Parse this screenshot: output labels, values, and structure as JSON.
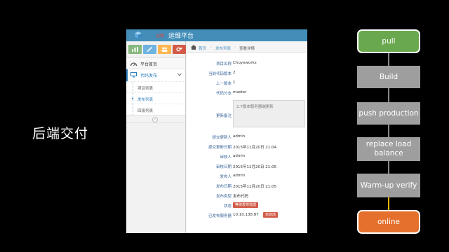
{
  "slide": {
    "title": "后端交付"
  },
  "app": {
    "brand": "运维平台",
    "logo_text": "运维",
    "shortcuts": [
      {
        "icon": "chart-icon",
        "color": "#87b87f"
      },
      {
        "icon": "pencil-icon",
        "color": "#6fb3e0"
      },
      {
        "icon": "users-icon",
        "color": "#ffb752"
      },
      {
        "icon": "cogs-icon",
        "color": "#d15b47"
      }
    ],
    "sidebar": {
      "home": "平台首页",
      "deploy": "代码发布",
      "sub_items": [
        "项目列表",
        "发布列表",
        "回滚列表"
      ],
      "collapse_glyph": "«"
    },
    "breadcrumb": [
      "首页",
      "发布列表",
      "查看详情"
    ],
    "breadcrumb_sep": "›",
    "details": [
      {
        "label": "项目名称",
        "value": "Chuyeworks"
      },
      {
        "label": "当前代码版本",
        "value": "2"
      },
      {
        "label": "上一版本",
        "value": "1"
      },
      {
        "label": "代码分支",
        "value": "master"
      },
      {
        "label": "更新备注",
        "value": "2.7版本服务器端更新"
      },
      {
        "label": "提交更新人",
        "value": "admin"
      },
      {
        "label": "提交更新日期",
        "value": "2015年11月20日 21:04"
      },
      {
        "label": "审核人",
        "value": "admin"
      },
      {
        "label": "审核日期",
        "value": "2015年11月20日 21:05"
      },
      {
        "label": "发布人",
        "value": "admin"
      },
      {
        "label": "发布日期",
        "value": "2015年11月20日 21:05"
      },
      {
        "label": "发布类型",
        "value": "发布代码"
      },
      {
        "label": "状态",
        "value": "等待发布完成"
      },
      {
        "label": "已发布服务器",
        "value": "10.10.138.87",
        "badge": "未启动"
      }
    ]
  },
  "flow": {
    "steps": [
      "pull",
      "Build",
      "push production",
      "replace load balance",
      "Warm-up verify",
      "online"
    ],
    "colors": {
      "start": "#6aa84f",
      "middle": "#9e9e9e",
      "end": "#e5702d",
      "last_connector": "#e3b40c"
    }
  }
}
